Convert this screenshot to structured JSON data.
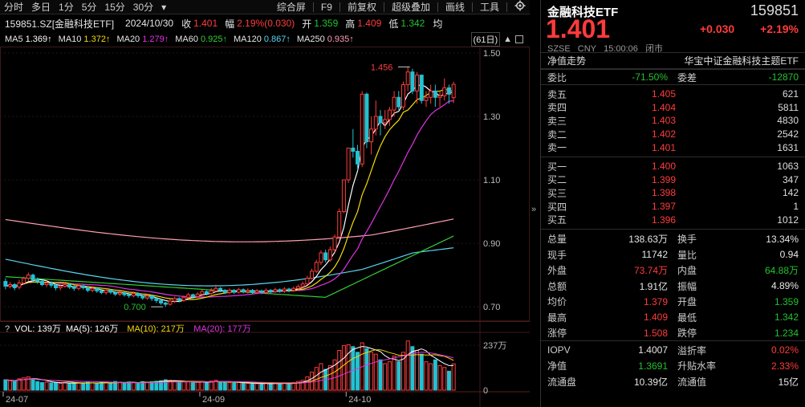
{
  "toolbar": {
    "left": [
      "分时",
      "多日",
      "1分",
      "5分",
      "15分",
      "30分"
    ],
    "dropdown_glyph": "▾",
    "right": [
      "综合屏",
      "F9",
      "前复权",
      "超级叠加",
      "画线",
      "工具"
    ]
  },
  "info": {
    "security": "159851.SZ[金融科技ETF]",
    "date": "2024/10/30",
    "close_label": "收",
    "close": "1.401",
    "amp_label": "幅",
    "amp": "2.19%(0.030)",
    "open_label": "开",
    "open": "1.359",
    "high_label": "高",
    "high": "1.409",
    "low_label": "低",
    "low": "1.342",
    "avg_label": "均"
  },
  "ma": {
    "ma5": "MA5",
    "ma5_v": "1.369↑",
    "ma10": "MA10",
    "ma10_v": "1.372↑",
    "ma20": "MA20",
    "ma20_v": "1.279↑",
    "ma60": "MA60",
    "ma60_v": "0.925↑",
    "ma120": "MA120",
    "ma120_v": "0.867↑",
    "ma250": "MA250",
    "ma250_v": "0.935↑",
    "days": "(61日)"
  },
  "colors": {
    "up": "#ff3b3b",
    "down": "#22c2d2",
    "ma5": "#ffffff",
    "ma10": "#f5d90a",
    "ma20": "#e033e0",
    "ma60": "#33cc33",
    "ma120": "#5ad4f0",
    "ma250": "#ff9fb4"
  },
  "chart_data": {
    "type": "candlestick",
    "price_ticks": [
      "1.50",
      "1.30",
      "1.10",
      "0.90",
      "0.70"
    ],
    "price_range": [
      0.66,
      1.52
    ],
    "x_ticks": [
      {
        "label": "24-07",
        "index": 0
      },
      {
        "label": "24-09",
        "index": 43
      },
      {
        "label": "24-10",
        "index": 75
      }
    ],
    "annotations": [
      {
        "text": "1.456",
        "index": 89,
        "value": 1.456
      },
      {
        "text": "0.700",
        "index": 35,
        "value": 0.7
      }
    ],
    "volume_info": {
      "vol": "VOL: 139万",
      "ma5": "MA(5): 126万",
      "ma10": "MA(10): 217万",
      "ma20": "MA(20): 177万",
      "expand_icon": "?"
    },
    "volume_ticks": [
      "237万",
      "0"
    ],
    "volume_range": [
      0,
      280
    ],
    "candles": [
      [
        0.78,
        0.765,
        0.79,
        0.755,
        55
      ],
      [
        0.765,
        0.77,
        0.778,
        0.758,
        50
      ],
      [
        0.77,
        0.76,
        0.775,
        0.752,
        48
      ],
      [
        0.762,
        0.775,
        0.785,
        0.755,
        60
      ],
      [
        0.775,
        0.79,
        0.795,
        0.77,
        65
      ],
      [
        0.79,
        0.8,
        0.808,
        0.782,
        70
      ],
      [
        0.8,
        0.785,
        0.805,
        0.778,
        58
      ],
      [
        0.785,
        0.78,
        0.792,
        0.772,
        45
      ],
      [
        0.78,
        0.77,
        0.785,
        0.765,
        40
      ],
      [
        0.77,
        0.775,
        0.782,
        0.762,
        42
      ],
      [
        0.775,
        0.768,
        0.78,
        0.76,
        38
      ],
      [
        0.768,
        0.76,
        0.772,
        0.752,
        40
      ],
      [
        0.76,
        0.765,
        0.77,
        0.752,
        36
      ],
      [
        0.765,
        0.77,
        0.778,
        0.76,
        39
      ],
      [
        0.77,
        0.762,
        0.774,
        0.756,
        35
      ],
      [
        0.762,
        0.758,
        0.768,
        0.75,
        38
      ],
      [
        0.758,
        0.766,
        0.772,
        0.752,
        40
      ],
      [
        0.766,
        0.76,
        0.77,
        0.754,
        36
      ],
      [
        0.76,
        0.752,
        0.764,
        0.746,
        42
      ],
      [
        0.752,
        0.758,
        0.765,
        0.746,
        38
      ],
      [
        0.758,
        0.75,
        0.762,
        0.744,
        35
      ],
      [
        0.75,
        0.745,
        0.756,
        0.74,
        44
      ],
      [
        0.745,
        0.752,
        0.758,
        0.738,
        40
      ],
      [
        0.752,
        0.746,
        0.756,
        0.74,
        37
      ],
      [
        0.746,
        0.74,
        0.75,
        0.734,
        46
      ],
      [
        0.74,
        0.744,
        0.75,
        0.734,
        41
      ],
      [
        0.744,
        0.738,
        0.748,
        0.732,
        39
      ],
      [
        0.738,
        0.735,
        0.744,
        0.728,
        43
      ],
      [
        0.735,
        0.742,
        0.748,
        0.73,
        40
      ],
      [
        0.742,
        0.735,
        0.746,
        0.728,
        38
      ],
      [
        0.735,
        0.728,
        0.738,
        0.722,
        45
      ],
      [
        0.728,
        0.734,
        0.74,
        0.722,
        41
      ],
      [
        0.734,
        0.726,
        0.738,
        0.718,
        44
      ],
      [
        0.726,
        0.72,
        0.73,
        0.712,
        47
      ],
      [
        0.72,
        0.712,
        0.724,
        0.706,
        50
      ],
      [
        0.712,
        0.708,
        0.716,
        0.7,
        55
      ],
      [
        0.708,
        0.718,
        0.724,
        0.704,
        52
      ],
      [
        0.718,
        0.726,
        0.732,
        0.712,
        48
      ],
      [
        0.726,
        0.72,
        0.73,
        0.714,
        40
      ],
      [
        0.72,
        0.73,
        0.736,
        0.716,
        44
      ],
      [
        0.73,
        0.738,
        0.744,
        0.724,
        46
      ],
      [
        0.738,
        0.732,
        0.742,
        0.726,
        39
      ],
      [
        0.732,
        0.74,
        0.746,
        0.728,
        42
      ],
      [
        0.74,
        0.748,
        0.754,
        0.734,
        45
      ],
      [
        0.748,
        0.742,
        0.752,
        0.736,
        40
      ],
      [
        0.742,
        0.75,
        0.76,
        0.738,
        48
      ],
      [
        0.75,
        0.758,
        0.77,
        0.746,
        52
      ],
      [
        0.758,
        0.752,
        0.762,
        0.746,
        42
      ],
      [
        0.752,
        0.745,
        0.756,
        0.74,
        44
      ],
      [
        0.745,
        0.752,
        0.758,
        0.74,
        40
      ],
      [
        0.752,
        0.746,
        0.756,
        0.74,
        38
      ],
      [
        0.746,
        0.754,
        0.76,
        0.742,
        41
      ],
      [
        0.754,
        0.748,
        0.758,
        0.742,
        37
      ],
      [
        0.748,
        0.752,
        0.758,
        0.742,
        36
      ],
      [
        0.752,
        0.745,
        0.756,
        0.74,
        35
      ],
      [
        0.745,
        0.75,
        0.756,
        0.74,
        34
      ],
      [
        0.75,
        0.746,
        0.754,
        0.74,
        33
      ],
      [
        0.746,
        0.752,
        0.758,
        0.742,
        36
      ],
      [
        0.752,
        0.748,
        0.756,
        0.742,
        34
      ],
      [
        0.748,
        0.754,
        0.76,
        0.744,
        37
      ],
      [
        0.754,
        0.75,
        0.758,
        0.744,
        35
      ],
      [
        0.75,
        0.756,
        0.762,
        0.744,
        38
      ],
      [
        0.756,
        0.752,
        0.76,
        0.746,
        36
      ],
      [
        0.752,
        0.758,
        0.764,
        0.748,
        40
      ],
      [
        0.758,
        0.764,
        0.77,
        0.752,
        46
      ],
      [
        0.764,
        0.772,
        0.78,
        0.758,
        52
      ],
      [
        0.772,
        0.79,
        0.798,
        0.768,
        70
      ],
      [
        0.79,
        0.812,
        0.82,
        0.786,
        95
      ],
      [
        0.812,
        0.84,
        0.848,
        0.806,
        120
      ],
      [
        0.84,
        0.87,
        0.878,
        0.832,
        140
      ],
      [
        0.87,
        0.848,
        0.88,
        0.84,
        110
      ],
      [
        0.848,
        0.88,
        0.89,
        0.842,
        130
      ],
      [
        0.88,
        0.92,
        0.928,
        0.872,
        160
      ],
      [
        0.92,
        1.0,
        1.01,
        0.915,
        210
      ],
      [
        1.0,
        1.1,
        1.1,
        0.995,
        235
      ],
      [
        1.1,
        1.2,
        1.2,
        1.09,
        240
      ],
      [
        1.2,
        1.19,
        1.26,
        1.17,
        230
      ],
      [
        1.19,
        1.15,
        1.21,
        1.13,
        200
      ],
      [
        1.15,
        1.37,
        1.38,
        1.14,
        250
      ],
      [
        1.37,
        1.22,
        1.375,
        1.2,
        220
      ],
      [
        1.22,
        1.26,
        1.3,
        1.18,
        200
      ],
      [
        1.26,
        1.3,
        1.35,
        1.24,
        190
      ],
      [
        1.3,
        1.28,
        1.32,
        1.24,
        160
      ],
      [
        1.28,
        1.29,
        1.32,
        1.26,
        140
      ],
      [
        1.29,
        1.32,
        1.33,
        1.27,
        150
      ],
      [
        1.32,
        1.36,
        1.38,
        1.3,
        180
      ],
      [
        1.36,
        1.33,
        1.38,
        1.32,
        150
      ],
      [
        1.33,
        1.4,
        1.41,
        1.32,
        200
      ],
      [
        1.4,
        1.44,
        1.456,
        1.38,
        260
      ],
      [
        1.44,
        1.38,
        1.45,
        1.37,
        230
      ],
      [
        1.38,
        1.43,
        1.44,
        1.34,
        210
      ],
      [
        1.43,
        1.35,
        1.432,
        1.34,
        190
      ],
      [
        1.35,
        1.36,
        1.38,
        1.33,
        150
      ],
      [
        1.36,
        1.38,
        1.4,
        1.34,
        140
      ],
      [
        1.38,
        1.36,
        1.4,
        1.33,
        160
      ],
      [
        1.36,
        1.365,
        1.38,
        1.33,
        130
      ],
      [
        1.365,
        1.39,
        1.42,
        1.35,
        120
      ],
      [
        1.39,
        1.37,
        1.4,
        1.34,
        100
      ],
      [
        1.359,
        1.401,
        1.409,
        1.342,
        139
      ]
    ]
  },
  "panel": {
    "name": "金融科技ETF",
    "code": "159851",
    "price": "1.401",
    "change": "+0.030",
    "pct": "+2.19%",
    "meta": [
      "SZSE",
      "CNY",
      "15:00:06",
      "闭市"
    ],
    "title_left": "净值走势",
    "title_right": "华宝中证金融科技主题ETF",
    "ratio_row": {
      "l1": "委比",
      "v1": "-71.50%",
      "l2": "委差",
      "v2": "-12870"
    },
    "asks": [
      {
        "label": "卖五",
        "price": "1.405",
        "vol": "621"
      },
      {
        "label": "卖四",
        "price": "1.404",
        "vol": "5811"
      },
      {
        "label": "卖三",
        "price": "1.403",
        "vol": "4830"
      },
      {
        "label": "卖二",
        "price": "1.402",
        "vol": "2542"
      },
      {
        "label": "卖一",
        "price": "1.401",
        "vol": "1631"
      }
    ],
    "bids": [
      {
        "label": "买一",
        "price": "1.400",
        "vol": "1063"
      },
      {
        "label": "买二",
        "price": "1.399",
        "vol": "347"
      },
      {
        "label": "买三",
        "price": "1.398",
        "vol": "142"
      },
      {
        "label": "买四",
        "price": "1.397",
        "vol": "1"
      },
      {
        "label": "买五",
        "price": "1.396",
        "vol": "1012"
      }
    ],
    "stats": [
      {
        "l1": "总量",
        "v1": "138.63万",
        "c1": "white",
        "l2": "换手",
        "v2": "13.34%",
        "c2": "white"
      },
      {
        "l1": "现手",
        "v1": "11742",
        "c1": "white",
        "l2": "量比",
        "v2": "0.94",
        "c2": "white"
      },
      {
        "l1": "外盘",
        "v1": "73.74万",
        "c1": "red",
        "l2": "内盘",
        "v2": "64.88万",
        "c2": "green"
      },
      {
        "l1": "总额",
        "v1": "1.91亿",
        "c1": "white",
        "l2": "振幅",
        "v2": "4.89%",
        "c2": "white"
      },
      {
        "l1": "均价",
        "v1": "1.379",
        "c1": "red",
        "l2": "开盘",
        "v2": "1.359",
        "c2": "green"
      },
      {
        "l1": "最高",
        "v1": "1.409",
        "c1": "red",
        "l2": "最低",
        "v2": "1.342",
        "c2": "green"
      },
      {
        "l1": "涨停",
        "v1": "1.508",
        "c1": "red",
        "l2": "跌停",
        "v2": "1.234",
        "c2": "green"
      }
    ],
    "stats2": [
      {
        "l1": "IOPV",
        "v1": "1.4007",
        "c1": "white",
        "l2": "溢折率",
        "v2": "0.02%",
        "c2": "red"
      },
      {
        "l1": "净值",
        "v1": "1.3691",
        "c1": "green",
        "l2": "升贴水率",
        "v2": "2.33%",
        "c2": "red"
      },
      {
        "l1": "流通盘",
        "v1": "10.39亿",
        "c1": "white",
        "l2": "流通值",
        "v2": "15亿",
        "c2": "white"
      }
    ]
  }
}
